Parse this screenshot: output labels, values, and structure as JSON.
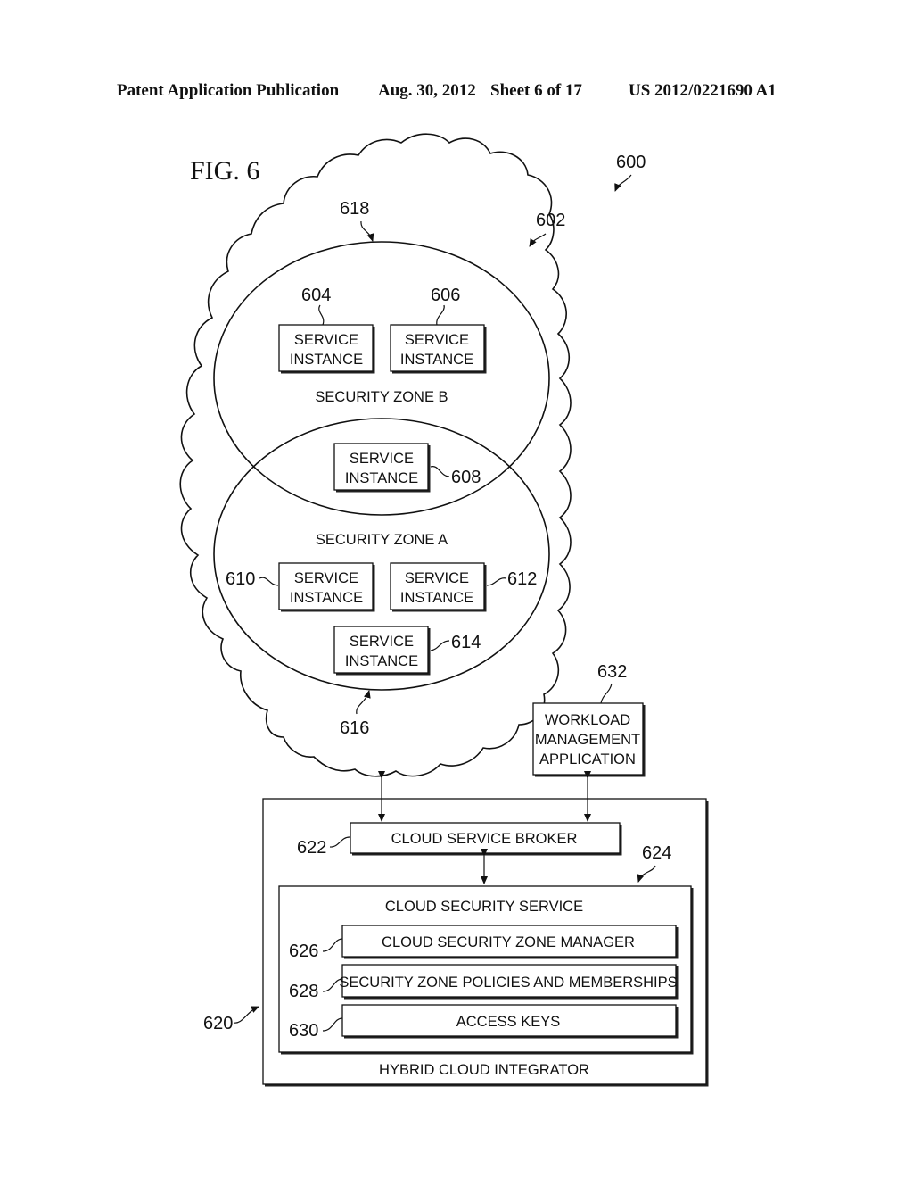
{
  "header": {
    "left": "Patent Application Publication",
    "date": "Aug. 30, 2012",
    "sheet": "Sheet 6 of 17",
    "number": "US 2012/0221690 A1"
  },
  "figure": {
    "title": "FIG. 6",
    "ref": "600"
  },
  "cloud": {
    "ref": "602",
    "zone_b": {
      "ref": "618",
      "label": "SECURITY ZONE B",
      "instances": [
        {
          "ref": "604",
          "line1": "SERVICE",
          "line2": "INSTANCE"
        },
        {
          "ref": "606",
          "line1": "SERVICE",
          "line2": "INSTANCE"
        }
      ]
    },
    "shared_instance": {
      "ref": "608",
      "line1": "SERVICE",
      "line2": "INSTANCE"
    },
    "zone_a": {
      "ref": "616",
      "label": "SECURITY ZONE A",
      "instances": [
        {
          "ref": "610",
          "line1": "SERVICE",
          "line2": "INSTANCE"
        },
        {
          "ref": "612",
          "line1": "SERVICE",
          "line2": "INSTANCE"
        },
        {
          "ref": "614",
          "line1": "SERVICE",
          "line2": "INSTANCE"
        }
      ]
    }
  },
  "workload_app": {
    "ref": "632",
    "line1": "WORKLOAD",
    "line2": "MANAGEMENT",
    "line3": "APPLICATION"
  },
  "integrator": {
    "ref": "620",
    "label": "HYBRID CLOUD INTEGRATOR",
    "broker": {
      "ref": "622",
      "label": "CLOUD SERVICE BROKER"
    },
    "security_service": {
      "ref": "624",
      "label": "CLOUD SECURITY SERVICE",
      "components": [
        {
          "ref": "626",
          "label": "CLOUD SECURITY ZONE MANAGER"
        },
        {
          "ref": "628",
          "label": "SECURITY ZONE POLICIES AND MEMBERSHIPS"
        },
        {
          "ref": "630",
          "label": "ACCESS KEYS"
        }
      ]
    }
  }
}
